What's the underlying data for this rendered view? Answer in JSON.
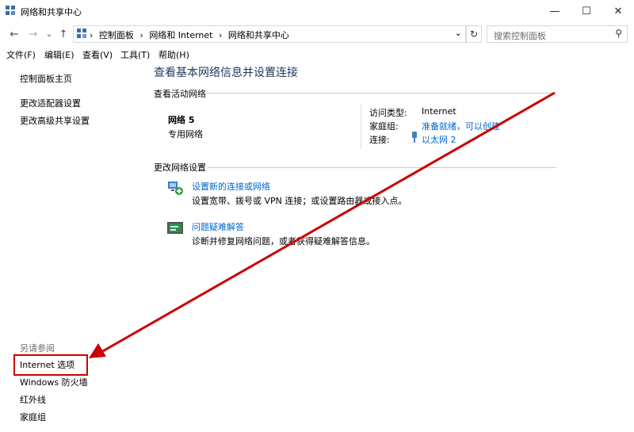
{
  "window": {
    "title": "网络和共享中心",
    "minimize": "—",
    "maximize": "☐",
    "close": "✕"
  },
  "nav": {
    "back": "←",
    "forward": "→",
    "recent": "⌄",
    "up": "↑",
    "breadcrumbs": [
      "控制面板",
      "网络和 Internet",
      "网络和共享中心"
    ],
    "separator": "›",
    "dropdown": "⌄",
    "refresh": "↻",
    "search_placeholder": "搜索控制面板",
    "search_icon": "⚲"
  },
  "menu": [
    "文件(F)",
    "编辑(E)",
    "查看(V)",
    "工具(T)",
    "帮助(H)"
  ],
  "left": {
    "home": "控制面板主页",
    "links": [
      "更改适配器设置",
      "更改高级共享设置"
    ],
    "see_also": "另请参阅",
    "see_also_links": [
      "Internet 选项",
      "Windows 防火墙",
      "红外线",
      "家庭组"
    ]
  },
  "main": {
    "heading": "查看基本网络信息并设置连接",
    "active_section": "查看活动网络",
    "network_name": "网络 5",
    "network_type": "专用网络",
    "access_type_label": "访问类型:",
    "access_type_value": "Internet",
    "homegroup_label": "家庭组:",
    "homegroup_value": "准备就绪，可以创建",
    "connection_label": "连接:",
    "connection_value": "以太网 2",
    "change_section": "更改网络设置",
    "tasks": [
      {
        "title": "设置新的连接或网络",
        "desc": "设置宽带、拨号或 VPN 连接；或设置路由器或接入点。"
      },
      {
        "title": "问题疑难解答",
        "desc": "诊断并修复网络问题，或者获得疑难解答信息。"
      }
    ]
  },
  "colors": {
    "link": "#0066cc",
    "heading": "#1e395b",
    "annotation": "#cc0000"
  }
}
